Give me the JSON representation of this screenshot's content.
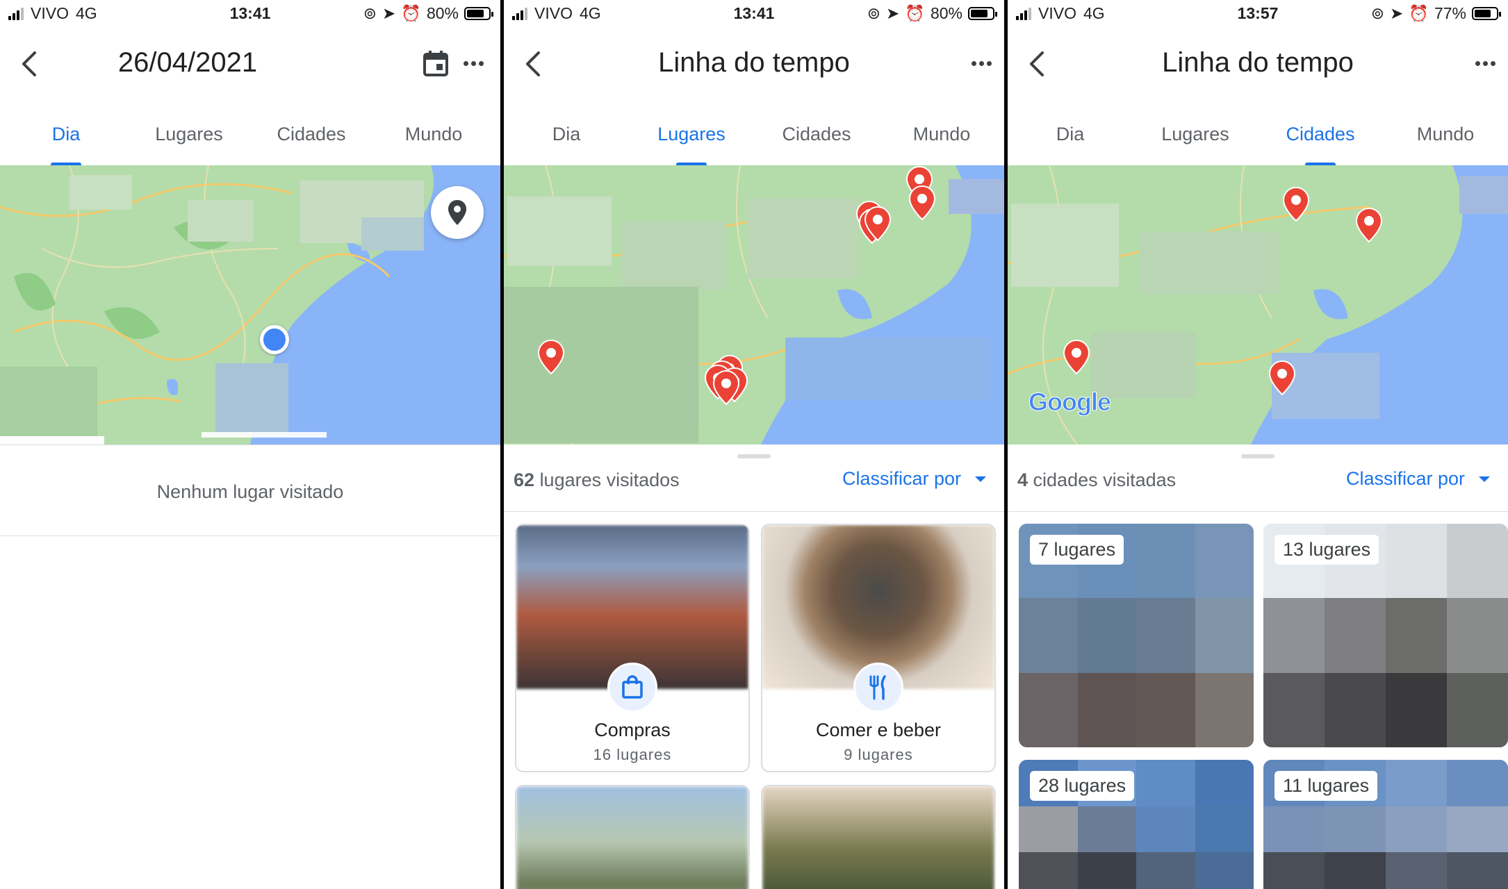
{
  "screens": [
    {
      "status": {
        "carrier": "VIVO",
        "network": "4G",
        "time": "13:41",
        "battery": "80%",
        "battery_level": 0.8
      },
      "header": {
        "title": "26/04/2021"
      },
      "tabs": [
        "Dia",
        "Lugares",
        "Cidades",
        "Mundo"
      ],
      "active_tab": 0,
      "empty_message": "Nenhum lugar visitado"
    },
    {
      "status": {
        "carrier": "VIVO",
        "network": "4G",
        "time": "13:41",
        "battery": "80%",
        "battery_level": 0.8
      },
      "header": {
        "title": "Linha do tempo"
      },
      "tabs": [
        "Dia",
        "Lugares",
        "Cidades",
        "Mundo"
      ],
      "active_tab": 1,
      "summary": {
        "count": "62",
        "label": "lugares visitados"
      },
      "sort_label": "Classificar por",
      "categories": [
        {
          "name": "Compras",
          "count": "16 lugares",
          "icon": "shopping-bag-icon"
        },
        {
          "name": "Comer e beber",
          "count": "9 lugares",
          "icon": "fork-knife-icon"
        }
      ]
    },
    {
      "status": {
        "carrier": "VIVO",
        "network": "4G",
        "time": "13:57",
        "battery": "77%",
        "battery_level": 0.77
      },
      "header": {
        "title": "Linha do tempo"
      },
      "tabs": [
        "Dia",
        "Lugares",
        "Cidades",
        "Mundo"
      ],
      "active_tab": 2,
      "summary": {
        "count": "4",
        "label": "cidades visitadas"
      },
      "sort_label": "Classificar por",
      "map_logo": "Google",
      "cities": [
        {
          "count": "7 lugares"
        },
        {
          "count": "13 lugares"
        },
        {
          "count": "28 lugares"
        },
        {
          "count": "11 lugares"
        }
      ]
    }
  ],
  "colors": {
    "accent": "#1a73e8",
    "pin": "#ea4335",
    "water": "#8ab4f8",
    "land": "#a8d8a0"
  },
  "icons": [
    "back-arrow-icon",
    "calendar-icon",
    "more-icon",
    "location-pin-icon",
    "shopping-bag-icon",
    "fork-knife-icon"
  ]
}
